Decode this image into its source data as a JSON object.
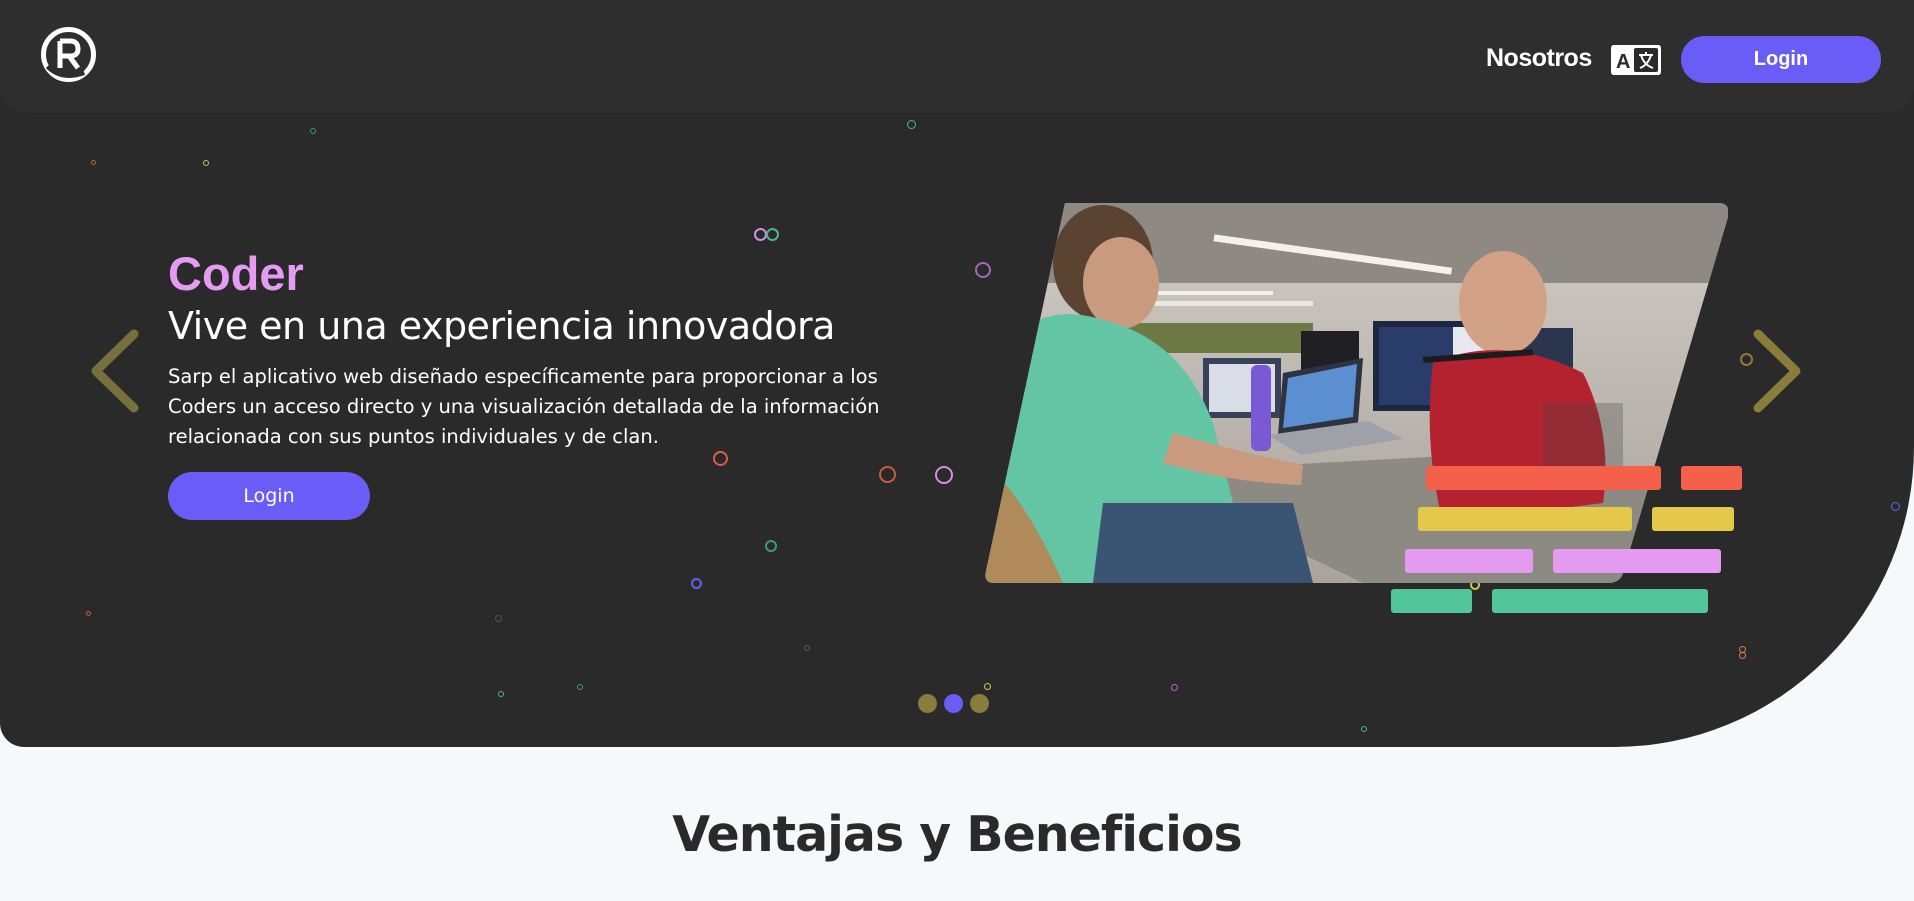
{
  "navbar": {
    "nav_link": "Nosotros",
    "translate_icon": "translate-icon",
    "login_label": "Login"
  },
  "hero": {
    "eyebrow": "Coder",
    "headline": "Vive en una experiencia innovadora",
    "description": "Sarp el aplicativo web diseñado específicamente para proporcionar a los Coders un acceso directo y una visualización detallada de la información relacionada con sus puntos individuales y de clan.",
    "login_label": "Login",
    "carousel": {
      "slide_count": 3,
      "active_index": 1,
      "prev_icon": "chevron-left-icon",
      "next_icon": "chevron-right-icon"
    }
  },
  "section": {
    "title": "Ventajas y Beneficios"
  },
  "colors": {
    "background_dark": "#2b2a2b",
    "accent_purple": "#6a5cf6",
    "accent_pink": "#e59bf2",
    "accent_olive": "#8a7c3a",
    "bar_red": "#f4604a",
    "bar_yellow": "#e5c84a",
    "bar_pink": "#e59bf2",
    "bar_green": "#52c59a"
  }
}
